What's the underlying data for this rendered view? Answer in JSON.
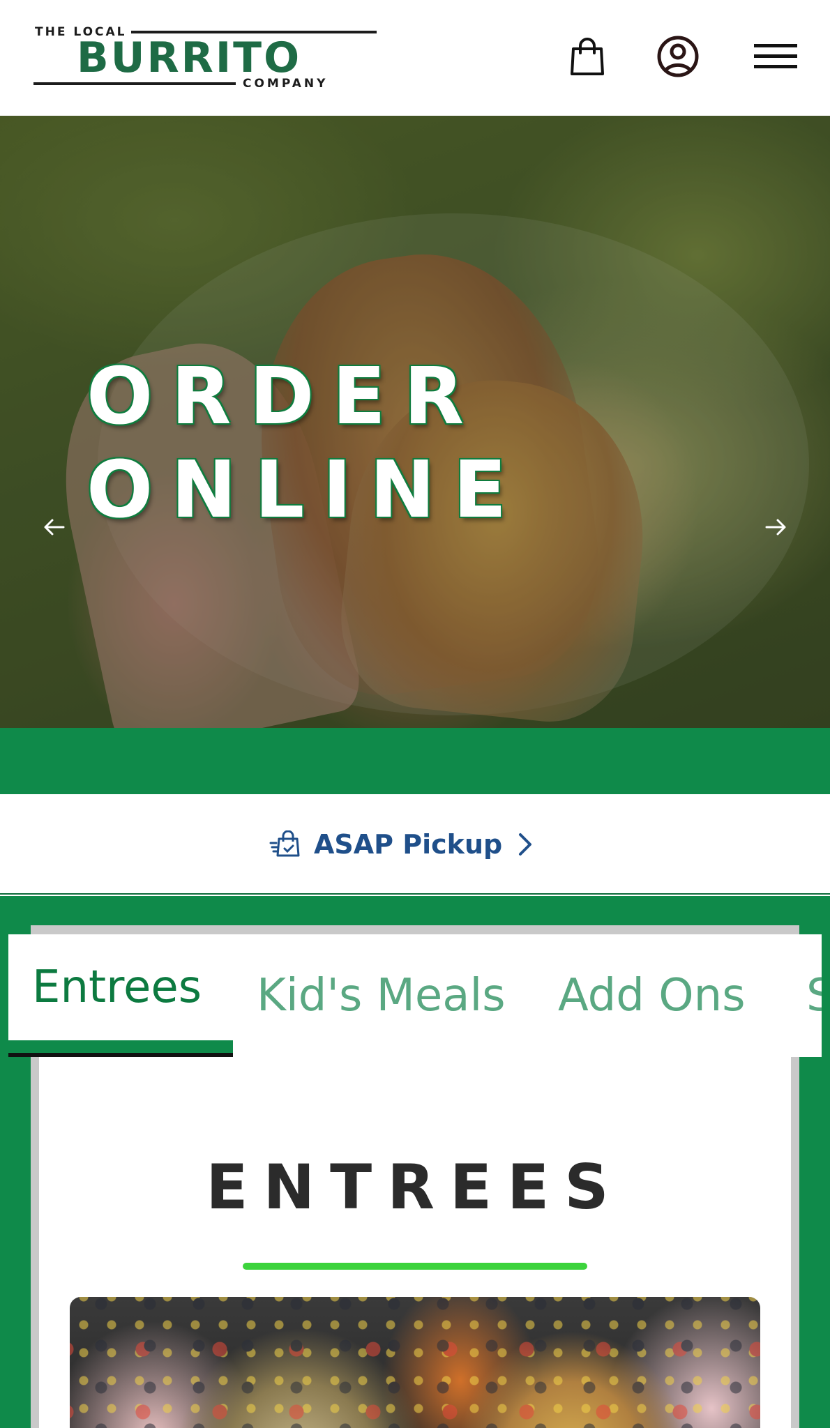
{
  "header": {
    "logo": {
      "line1": "THE LOCAL",
      "line2": "BURRITO",
      "line3": "COMPANY"
    },
    "icons": [
      "shopping-bag-icon",
      "user-account-icon",
      "hamburger-menu-icon"
    ]
  },
  "hero": {
    "title_line1": "ORDER",
    "title_line2": "ONLINE"
  },
  "pickup": {
    "label": "ASAP Pickup"
  },
  "menu": {
    "tabs": [
      {
        "label": "Entrees",
        "active": true
      },
      {
        "label": "Kid's Meals",
        "active": false
      },
      {
        "label": "Add Ons",
        "active": false
      },
      {
        "label": "S",
        "active": false
      }
    ],
    "section_title": "ENTREES"
  },
  "colors": {
    "brand_green": "#0f8a4a",
    "logo_green": "#1e6b45",
    "tab_active": "#0c7a40",
    "tab_inactive": "#5aa882",
    "pickup_text": "#1f4f8a",
    "title_rule": "#3cd33c"
  }
}
